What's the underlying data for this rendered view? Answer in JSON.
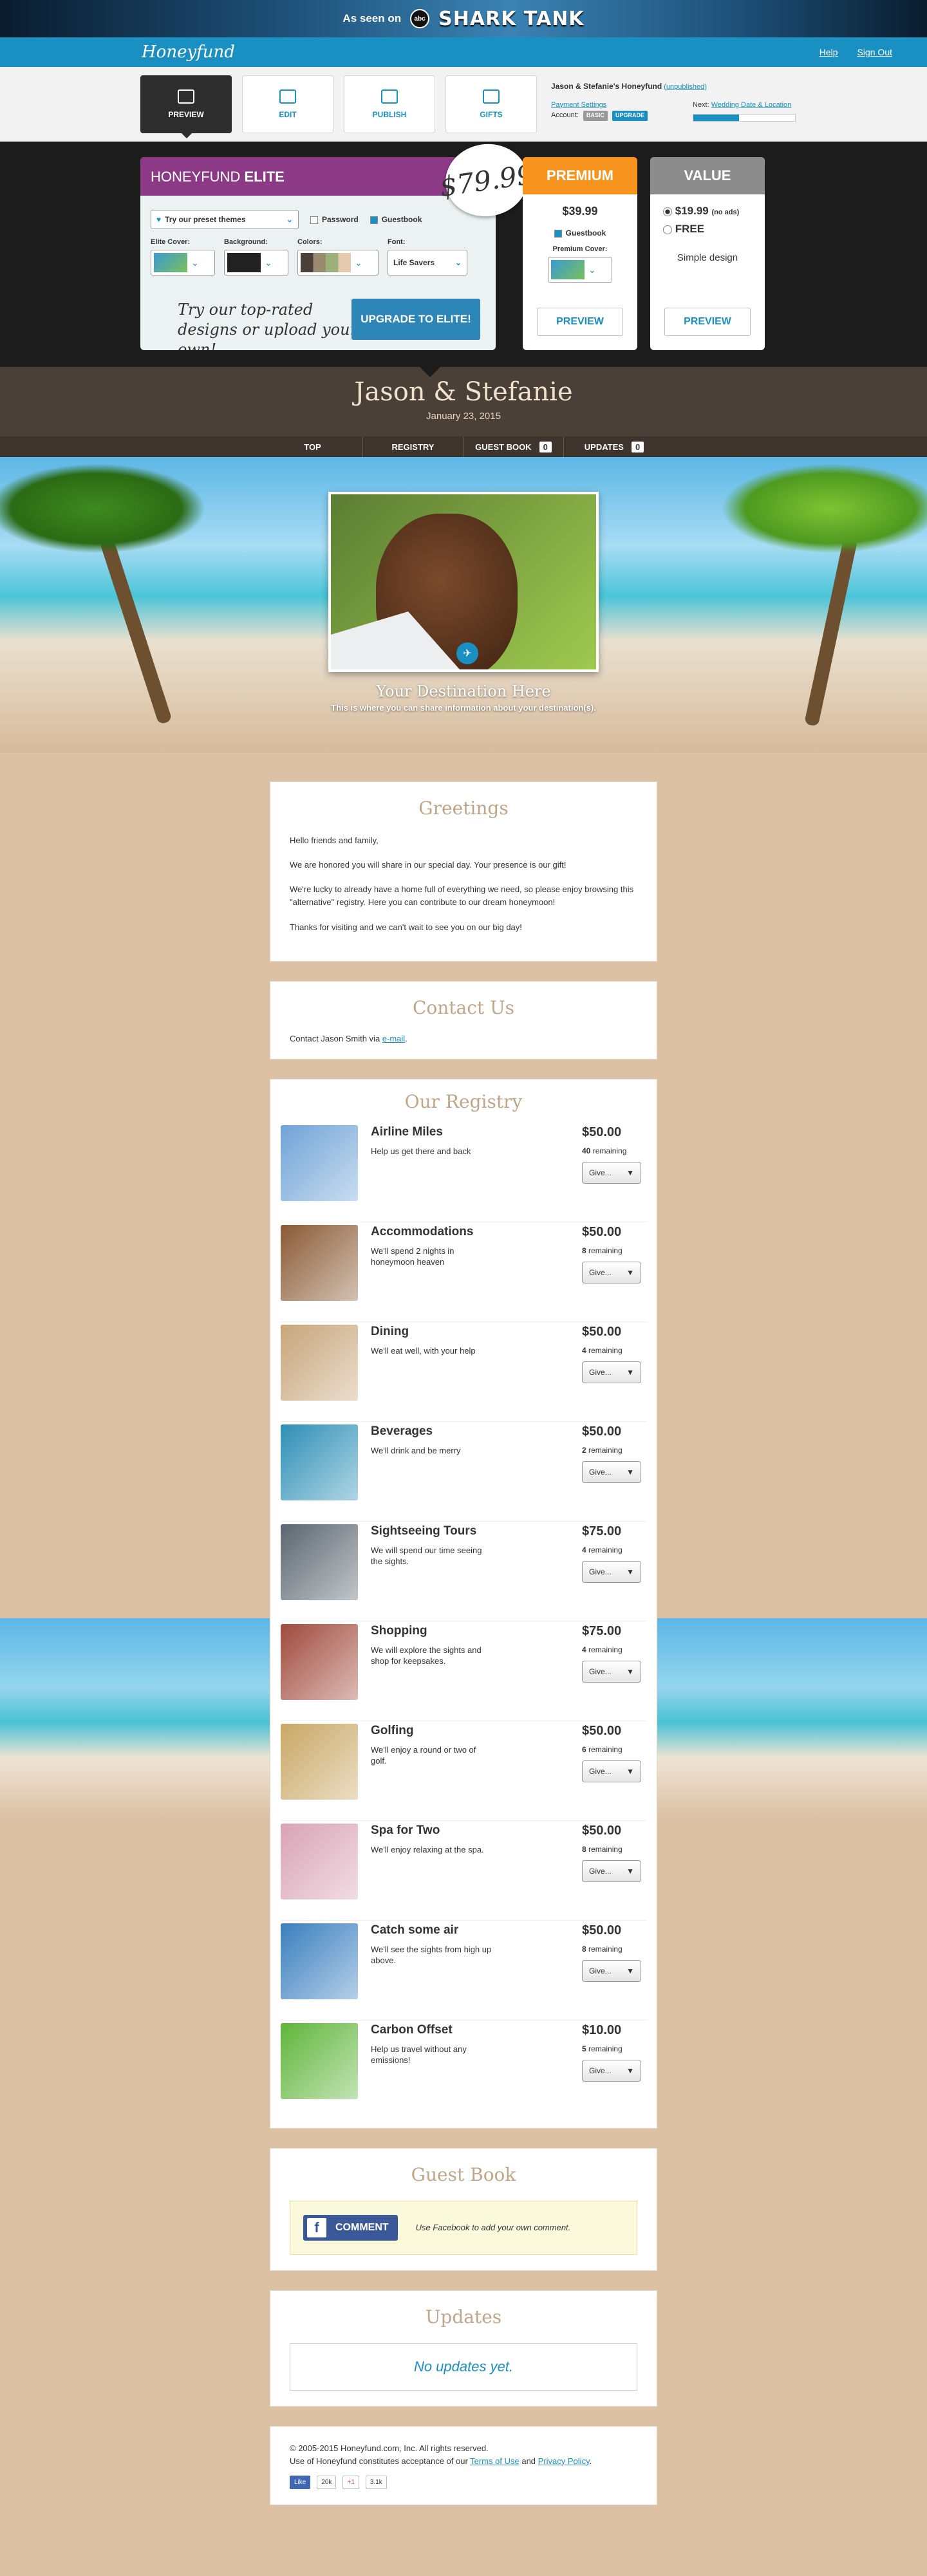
{
  "promo": {
    "seen": "As seen on",
    "abc": "abc",
    "show": "SHARK TANK"
  },
  "topbar": {
    "logo": "Honeyfund",
    "help": "Help",
    "signout": "Sign Out"
  },
  "toolbar": {
    "buttons": [
      {
        "label": "PREVIEW",
        "icon": "magnifier-icon",
        "active": true
      },
      {
        "label": "EDIT",
        "icon": "pencil-icon",
        "active": false
      },
      {
        "label": "PUBLISH",
        "icon": "share-icon",
        "active": false
      },
      {
        "label": "GIFTS",
        "icon": "gift-icon",
        "active": false
      }
    ],
    "fund_name": "Jason & Stefanie's Honeyfund",
    "fund_status": "(unpublished)",
    "payment_settings": "Payment Settings",
    "account_label": "Account:",
    "account_plan": "BASIC",
    "upgrade_label": "UPGRADE",
    "next_label": "Next:",
    "next_link": "Wedding Date & Location",
    "progress": 0.45
  },
  "themes": {
    "elite_title_prefix": "HONEYFUND",
    "elite_title": "ELITE",
    "elite_price": "$79.99",
    "preset_label": "Try our preset themes",
    "password_label": "Password",
    "guestbook_label": "Guestbook",
    "elite_cover_label": "Elite Cover:",
    "background_label": "Background:",
    "colors_label": "Colors:",
    "font_label": "Font:",
    "font_value": "Life Savers",
    "tagline": "Try our top-rated designs or upload your own!",
    "upgrade_elite": "UPGRADE TO ELITE!",
    "premium_title": "PREMIUM",
    "premium_price": "$39.99",
    "premium_guestbook": "Guestbook",
    "premium_cover": "Premium Cover:",
    "value_title": "VALUE",
    "value_price": "$19.99",
    "value_note": "(no ads)",
    "free_label": "FREE",
    "simple_design": "Simple design",
    "preview_label": "PREVIEW",
    "colors": {
      "elite": "#8c3a85",
      "premium": "#f7941d",
      "value": "#8c8c8c"
    }
  },
  "header": {
    "names": "Jason & Stefanie",
    "date": "January 23, 2015"
  },
  "nav": {
    "top": "TOP",
    "registry": "REGISTRY",
    "guestbook": "GUEST BOOK",
    "guestbook_count": "0",
    "updates": "UPDATES",
    "updates_count": "0"
  },
  "hero": {
    "dest_title": "Your Destination Here",
    "dest_sub": "This is where you can share information about your destination(s)."
  },
  "greetings": {
    "title": "Greetings",
    "p1": "Hello friends and family,",
    "p2": "We are honored you will share in our special day. Your presence is our gift!",
    "p3": "We're lucky to already have a home full of everything we need, so please enjoy browsing this \"alternative\" registry. Here you can contribute to our dream honeymoon!",
    "p4": "Thanks for visiting and we can't wait to see you on our big day!"
  },
  "contact": {
    "title": "Contact Us",
    "text": "Contact Jason Smith via ",
    "link": "e-mail",
    "end": "."
  },
  "registry": {
    "title": "Our Registry",
    "give_label": "Give...",
    "remaining_label": "remaining",
    "items": [
      {
        "name": "Airline Miles",
        "desc": "Help us get there and back",
        "price": "$50.00",
        "remaining": "40",
        "color": "#6fa3d6"
      },
      {
        "name": "Accommodations",
        "desc": "We'll spend 2 nights in honeymoon heaven",
        "price": "$50.00",
        "remaining": "8",
        "color": "#8a5a34"
      },
      {
        "name": "Dining",
        "desc": "We'll eat well, with your help",
        "price": "$50.00",
        "remaining": "4",
        "color": "#c7a57a"
      },
      {
        "name": "Beverages",
        "desc": "We'll drink and be merry",
        "price": "$50.00",
        "remaining": "2",
        "color": "#2d8fb6"
      },
      {
        "name": "Sightseeing Tours",
        "desc": "We will spend our time seeing the sights.",
        "price": "$75.00",
        "remaining": "4",
        "color": "#5b6670"
      },
      {
        "name": "Shopping",
        "desc": "We will explore the sights and shop for keepsakes.",
        "price": "$75.00",
        "remaining": "4",
        "color": "#a04a3c"
      },
      {
        "name": "Golfing",
        "desc": "We'll enjoy a round or two of golf.",
        "price": "$50.00",
        "remaining": "6",
        "color": "#c9a765"
      },
      {
        "name": "Spa for Two",
        "desc": "We'll enjoy relaxing at the spa.",
        "price": "$50.00",
        "remaining": "8",
        "color": "#d9a3b5"
      },
      {
        "name": "Catch some air",
        "desc": "We'll see the sights from high up above.",
        "price": "$50.00",
        "remaining": "8",
        "color": "#3a7fbe"
      },
      {
        "name": "Carbon Offset",
        "desc": "Help us travel without any emissions!",
        "price": "$10.00",
        "remaining": "5",
        "color": "#5fb53a"
      }
    ]
  },
  "guestbook": {
    "title": "Guest Book",
    "button": "COMMENT",
    "note": "Use Facebook to add your own comment."
  },
  "updates": {
    "title": "Updates",
    "empty": "No updates yet."
  },
  "footer": {
    "copyright": "© 2005-2015 Honeyfund.com, Inc. All rights reserved.",
    "terms_prefix": "Use of Honeyfund constitutes acceptance of our ",
    "terms": "Terms of Use",
    "and": " and ",
    "privacy": "Privacy Policy",
    "end": ".",
    "fb_like": "Like",
    "fb_count": "20k",
    "gplus": "+1",
    "gplus_count": "3.1k"
  }
}
